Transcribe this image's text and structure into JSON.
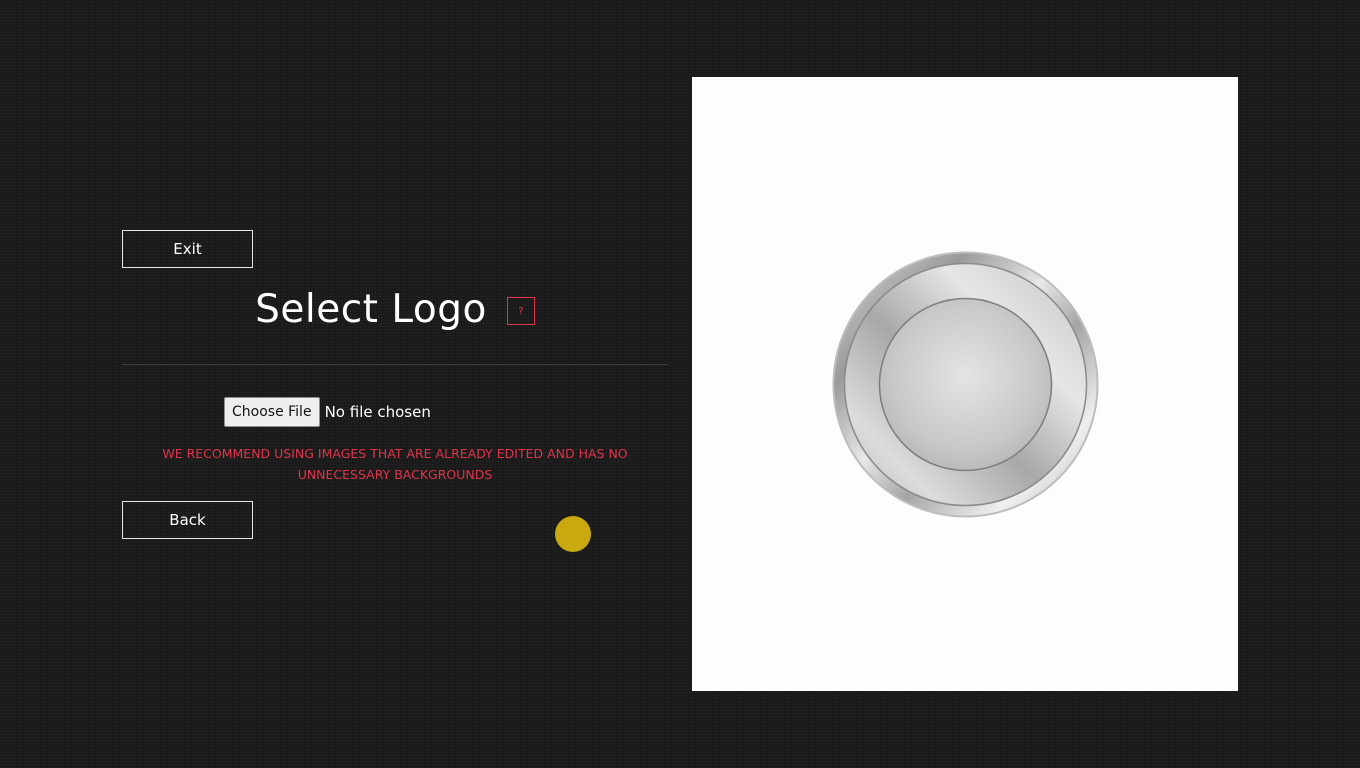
{
  "buttons": {
    "exit_label": "Exit",
    "back_label": "Back"
  },
  "header": {
    "title": "Select Logo",
    "help_label": "?"
  },
  "file_input": {
    "button_label": "Choose File",
    "status": "No file chosen"
  },
  "warning_text": "WE RECOMMEND USING IMAGES THAT ARE ALREADY EDITED AND HAS NO UNNECESSARY BACKGROUNDS",
  "preview": {
    "image": "silver-coin-logo"
  },
  "colors": {
    "background": "#191919",
    "accent_red": "#e0344b",
    "cursor_yellow": "#c9a90f",
    "panel": "#fdfdfd"
  }
}
